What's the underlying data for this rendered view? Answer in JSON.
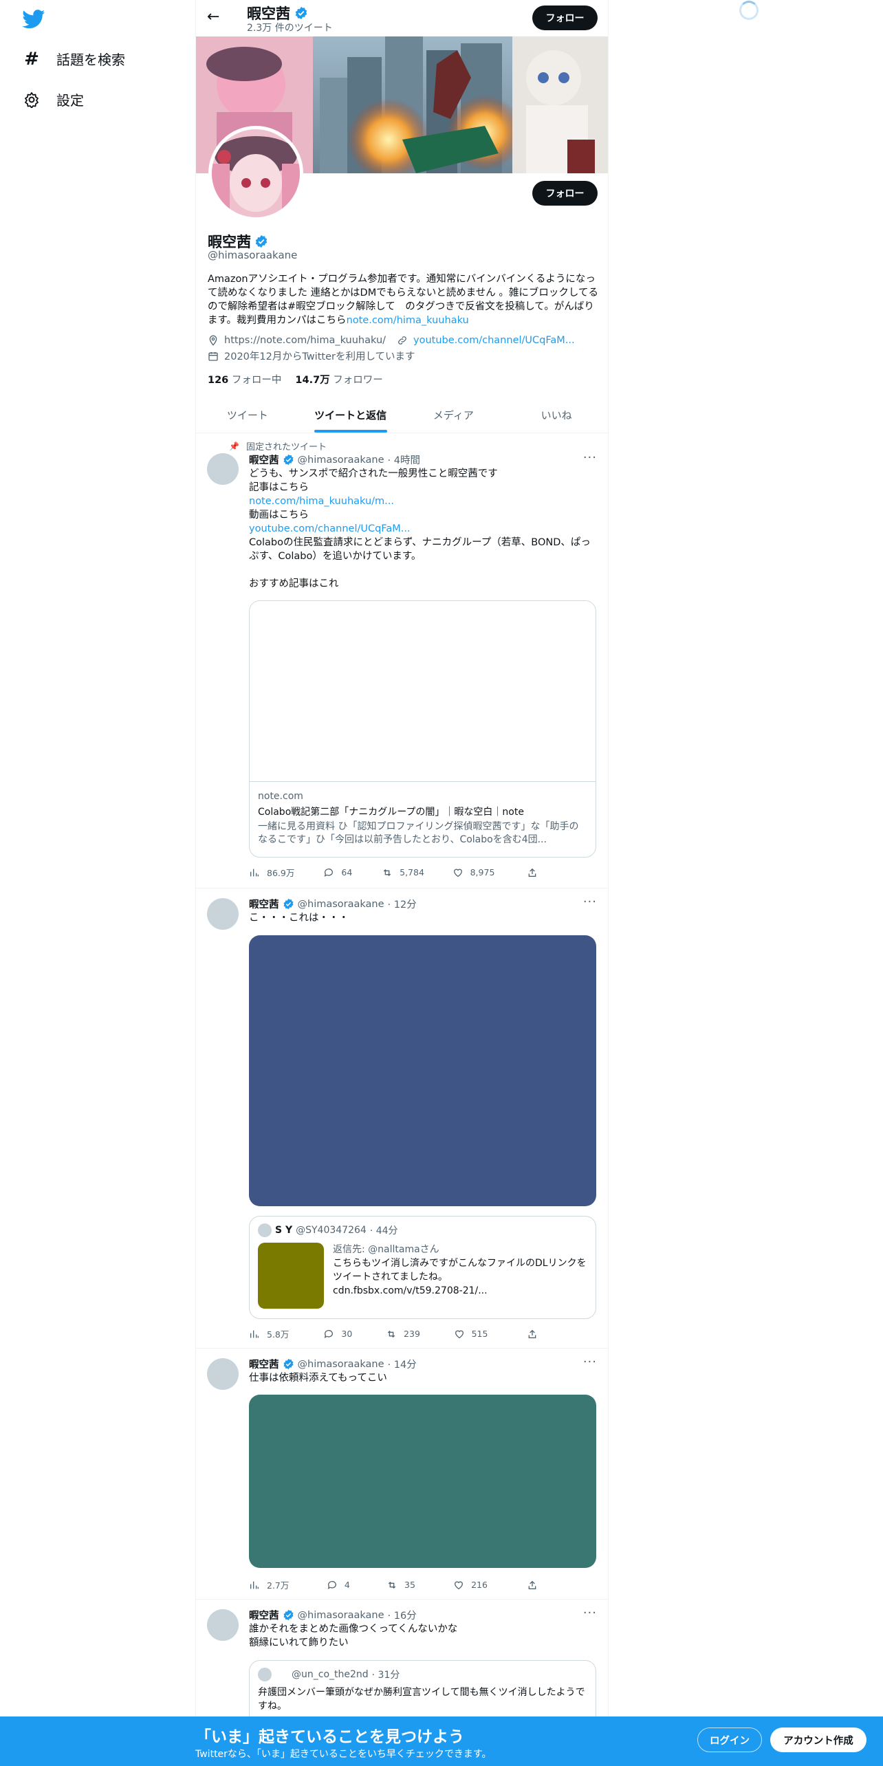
{
  "nav": {
    "logo_icon": "twitter-bird-icon",
    "items": [
      {
        "icon": "hashtag-icon",
        "label": "話題を検索"
      },
      {
        "icon": "gear-icon",
        "label": "設定"
      }
    ]
  },
  "header": {
    "name": "暇空茜",
    "tweet_count": "2.3万 件のツイート",
    "follow_label": "フォロー"
  },
  "profile": {
    "name": "暇空茜",
    "handle": "@himasoraakane",
    "follow_label": "フォロー",
    "bio_text": "Amazonアソシエイト・プログラム参加者です。通知常にバインバインくるようになって読めなくなりました 連絡とかはDMでもらえないと読めません 。雑にブロックしてるので解除希望者は#暇空ブロック解除して　のタグつきで反省文を投稿して。がんばります。裁判費用カンパはこちら",
    "bio_link": "note.com/hima_kuuhaku",
    "location": "https://note.com/hima_kuuhaku/",
    "website": "youtube.com/channel/UCqFaM...",
    "joined": "2020年12月からTwitterを利用しています",
    "following_count": "126",
    "following_label": "フォロー中",
    "followers_count": "14.7万",
    "followers_label": "フォロワー"
  },
  "tabs": [
    {
      "label": "ツイート",
      "active": false
    },
    {
      "label": "ツイートと返信",
      "active": true
    },
    {
      "label": "メディア",
      "active": false
    },
    {
      "label": "いいね",
      "active": false
    }
  ],
  "tweets": [
    {
      "pinned_label": "固定されたツイート",
      "name": "暇空茜",
      "handle": "@himasoraakane",
      "time": "· 4時間",
      "lines": [
        "どうも、サンスポで紹介された一般男性こと暇空茜です",
        "記事はこちら",
        "note.com/hima_kuuhaku/m...",
        "動画はこちら",
        "youtube.com/channel/UCqFaM...",
        "Colaboの住民監査請求にとどまらず、ナニカグループ（若草、BOND、ぱっぷす、Colabo）を追いかけています。",
        "",
        "おすすめ記事はこれ"
      ],
      "card": {
        "domain": "note.com",
        "title": "Colabo戦記第二部「ナニカグループの闇」｜暇な空白｜note",
        "desc": "一緒に見る用資料 ひ「認知プロファイリング探偵暇空茜です」な「助手のなるこです」ひ「今回は以前予告したとおり、Colaboを含む4団..."
      },
      "views": "86.9万",
      "replies": "64",
      "retweets": "5,784",
      "likes": "8,975"
    },
    {
      "name": "暇空茜",
      "handle": "@himasoraakane",
      "time": "· 12分",
      "text": "こ・・・これは・・・",
      "media_color": "#3f5586",
      "quote": {
        "name": "S Y",
        "handle": "@SY40347264",
        "time": "· 44分",
        "reply_to": "返信先: @nalltamaさん",
        "text": "こちらもツイ消し済みですがこんなファイルのDLリンクをツイートされてましたね。",
        "link": "cdn.fbsbx.com/v/t59.2708-21/...",
        "thumb_color": "#7a7a00"
      },
      "views": "5.8万",
      "replies": "30",
      "retweets": "239",
      "likes": "515"
    },
    {
      "name": "暇空茜",
      "handle": "@himasoraakane",
      "time": "· 14分",
      "text": "仕事は依頼料添えてもってこい",
      "media_color": "#3a7672",
      "views": "2.7万",
      "replies": "4",
      "retweets": "35",
      "likes": "216"
    },
    {
      "name": "暇空茜",
      "handle": "@himasoraakane",
      "time": "· 16分",
      "lines": [
        "誰かそれをまとめた画像つくってくんないかな",
        "額縁にいれて飾りたい"
      ],
      "quote": {
        "handle": "@un_co_the2nd",
        "time": "· 31分",
        "text": "弁護団メンバー筆頭がなぜか勝利宣言ツイして間も無くツイ消ししたようですね。"
      }
    }
  ],
  "bottom_bar": {
    "title": "「いま」起きていることを見つけよう",
    "subtitle": "Twitterなら、「いま」起きていることをいち早くチェックできます。",
    "login": "ログイン",
    "signup": "アカウント作成"
  },
  "colors": {
    "accent": "#1d9bf0",
    "text": "#0f1419",
    "muted": "#536471"
  }
}
